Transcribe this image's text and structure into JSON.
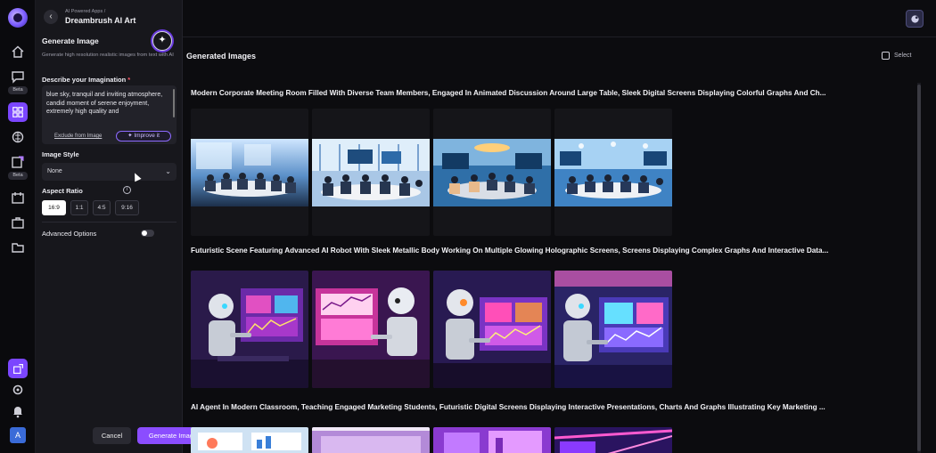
{
  "sidebar": {
    "beta_label_1": "Beta",
    "beta_label_2": "Beta",
    "avatar_letter": "A"
  },
  "panel": {
    "breadcrumb": "AI Powered Apps /",
    "app_title": "Dreambrush AI Art",
    "heading": "Generate Image",
    "subtitle": "Generate high resolution realistic images from text with AI",
    "prompt_label": "Describe your Imagination",
    "prompt_required": "*",
    "prompt_text": "blue sky, tranquil and inviting atmosphere, candid moment of serene enjoyment, extremely high quality and",
    "exclude_link": "Exclude from Image",
    "improve_button": "✦ Improve it",
    "style_label": "Image Style",
    "style_value": "None",
    "aspect_label": "Aspect Ratio",
    "aspect_options": [
      "16:9",
      "1:1",
      "4:5",
      "9:16"
    ],
    "aspect_selected": "16:9",
    "advanced_label": "Advanced Options",
    "advanced_enabled": false,
    "cancel_button": "Cancel",
    "generate_button": "Generate Image"
  },
  "main": {
    "title": "Generated Images",
    "select_label": "Select",
    "groups": [
      {
        "title": "Modern Corporate Meeting Room Filled With Diverse Team Members, Engaged In Animated Discussion Around Large Table, Sleek Digital Screens Displaying Colorful Graphs And Ch..."
      },
      {
        "title": "Futuristic Scene Featuring Advanced AI Robot With Sleek Metallic Body Working On Multiple Glowing Holographic Screens, Screens Displaying Complex Graphs And Interactive Data..."
      },
      {
        "title": "AI Agent In Modern Classroom, Teaching Engaged Marketing Students, Futuristic Digital Screens Displaying Interactive Presentations, Charts And Graphs Illustrating Key Marketing ..."
      }
    ]
  },
  "colors": {
    "accent": "#8b4dff",
    "background": "#0c0c0f",
    "panel": "#17171c"
  }
}
